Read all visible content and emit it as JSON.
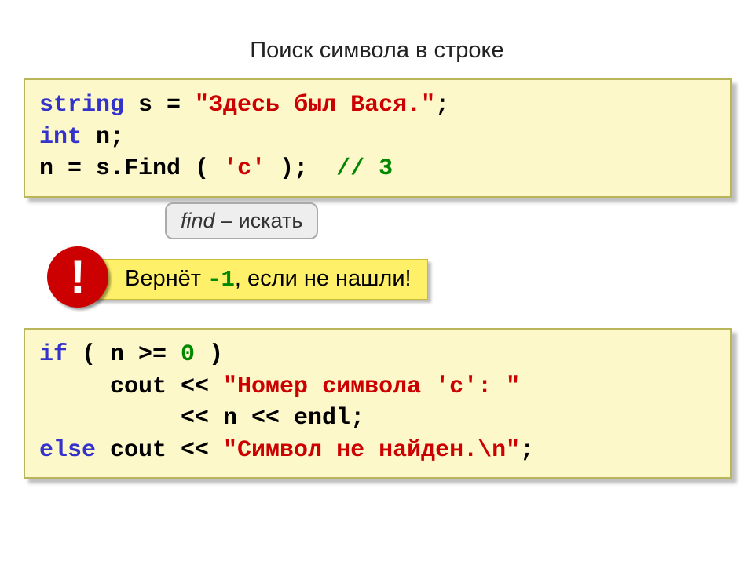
{
  "title": "Поиск символа в строке",
  "code1": {
    "l1a": "string",
    "l1b": " s = ",
    "l1c": "\"Здесь был Вася.\"",
    "l1d": ";",
    "l2a": "int",
    "l2b": " n;",
    "l3a": "n = s.",
    "l3b": "Find",
    "l3c": " ( ",
    "l3d": "'с'",
    "l3e": " );  ",
    "l3f": "// 3"
  },
  "tip": {
    "a": "find",
    "b": " – искать"
  },
  "warn": {
    "a": "Вернёт ",
    "b": "-1",
    "c": ", если не нашли!"
  },
  "bang": "!",
  "code2": {
    "l1a": "if",
    "l1b": " ( n >= ",
    "l1c": "0",
    "l1d": " )",
    "l2a": "     cout << ",
    "l2b": "\"Номер символа 'c': \"",
    "l3a": "          << n << endl;",
    "l4a": "else",
    "l4b": " cout << ",
    "l4c": "\"Символ не найден.\\n\"",
    "l4d": ";"
  }
}
